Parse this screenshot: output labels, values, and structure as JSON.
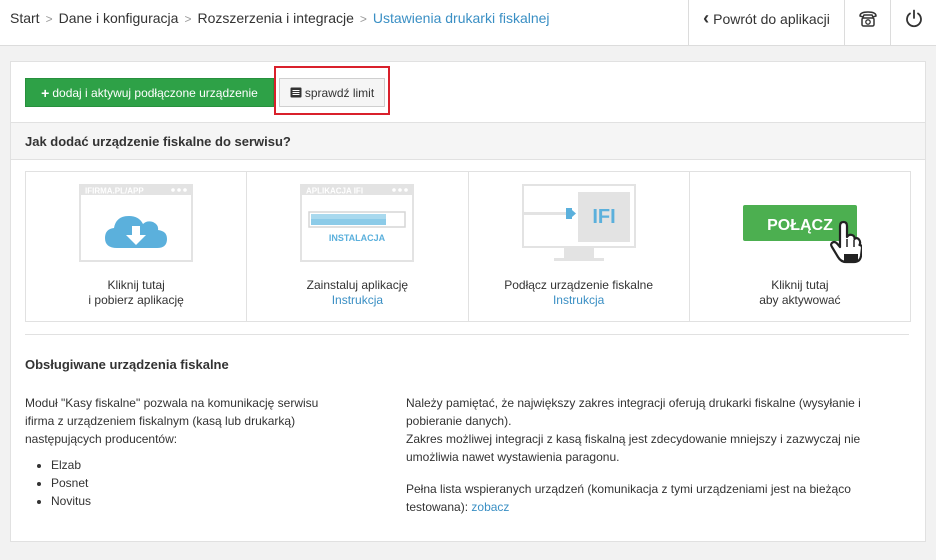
{
  "breadcrumb": {
    "items": [
      "Start",
      "Dane i konfiguracja",
      "Rozszerzenia i integracje"
    ],
    "current": "Ustawienia drukarki fiskalnej",
    "separator": ">"
  },
  "topbar": {
    "back_label": "Powrót do aplikacji",
    "back_icon": "chevron-left-icon",
    "phone_icon": "phone-icon",
    "power_icon": "power-icon"
  },
  "toolbar": {
    "add_label": "dodaj i aktywuj podłączone urządzenie",
    "add_icon": "plus-icon",
    "limit_label": "sprawdź limit",
    "limit_icon": "list-icon",
    "highlight_color": "#d9202b"
  },
  "howto": {
    "title": "Jak dodać urządzenie fiskalne do serwisu?"
  },
  "steps": [
    {
      "art_label": "IFIRMA.PL/APP",
      "line1": "Kliknij tutaj",
      "line2": "i pobierz aplikację",
      "icon": "cloud-download-icon"
    },
    {
      "art_label": "APLIKACJA IFI",
      "art_sub": "INSTALACJA",
      "line1": "Zainstaluj aplikację",
      "link": "Instrukcja",
      "icon": "install-progress-icon"
    },
    {
      "art_label": "IFI",
      "line1": "Podłącz urządzenie fiskalne",
      "link": "Instrukcja",
      "icon": "usb-monitor-icon"
    },
    {
      "art_label": "POŁĄCZ",
      "line1": "Kliknij tutaj",
      "line2": "aby aktywować",
      "icon": "hand-pointer-icon"
    }
  ],
  "devices": {
    "title": "Obsługiwane urządzenia fiskalne",
    "left_text": "Moduł \"Kasy fiskalne\" pozwala na komunikację serwisu ifirma z urządzeniem fiskalnym (kasą lub drukarką) następujących producentów:",
    "producers": [
      "Elzab",
      "Posnet",
      "Novitus"
    ],
    "right_p1": "Należy pamiętać, że największy zakres integracji oferują drukarki fiskalne (wysyłanie i pobieranie danych).",
    "right_p2": "Zakres możliwej integracji z kasą fiskalną jest zdecydowanie mniejszy i zazwyczaj nie umożliwia nawet wystawienia paragonu.",
    "right_p3": "Pełna lista wspieranych urządzeń (komunikacja z tymi urządzeniami jest na bieżąco testowana):",
    "right_link": "zobacz"
  },
  "colors": {
    "accent": "#3a8fc4",
    "green": "#2ea147",
    "light_blue": "#5bb0dc"
  }
}
